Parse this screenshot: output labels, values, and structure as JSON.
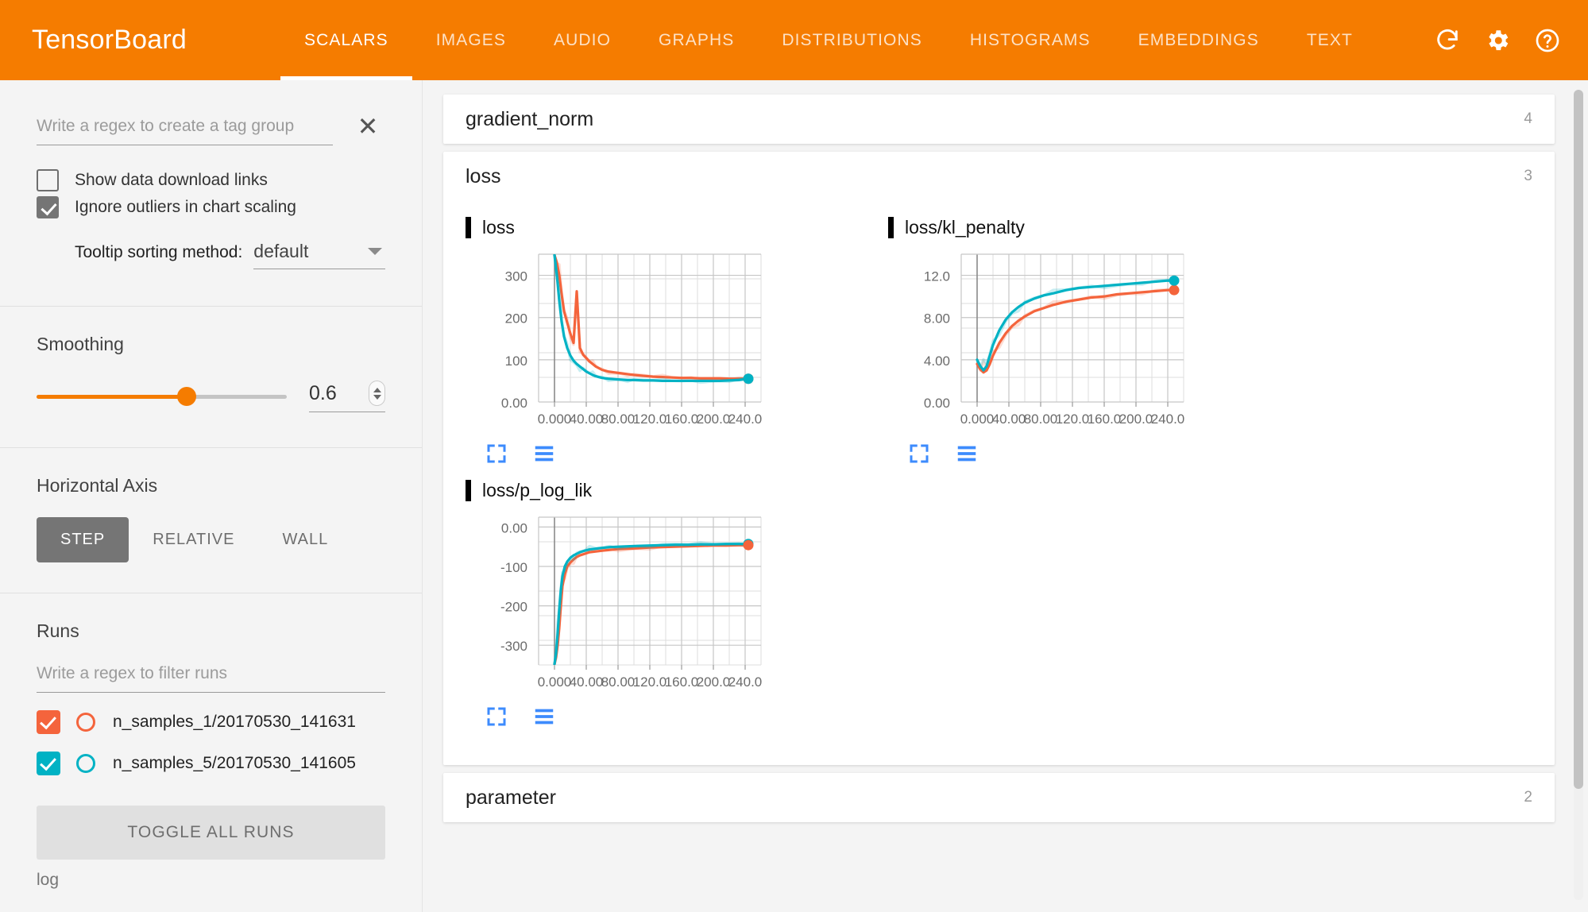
{
  "header": {
    "brand": "TensorBoard",
    "tabs": [
      {
        "label": "SCALARS",
        "active": true
      },
      {
        "label": "IMAGES",
        "active": false
      },
      {
        "label": "AUDIO",
        "active": false
      },
      {
        "label": "GRAPHS",
        "active": false
      },
      {
        "label": "DISTRIBUTIONS",
        "active": false
      },
      {
        "label": "HISTOGRAMS",
        "active": false
      },
      {
        "label": "EMBEDDINGS",
        "active": false
      },
      {
        "label": "TEXT",
        "active": false
      }
    ],
    "icons": [
      "refresh-icon",
      "settings-gear-icon",
      "help-icon"
    ],
    "background": "#f57c00"
  },
  "sidebar": {
    "tag_group_placeholder": "Write a regex to create a tag group",
    "tag_group_value": "",
    "clear_icon": "close-icon",
    "checkboxes": [
      {
        "label": "Show data download links",
        "checked": false
      },
      {
        "label": "Ignore outliers in chart scaling",
        "checked": true
      }
    ],
    "tooltip_sort": {
      "label": "Tooltip sorting method:",
      "value": "default"
    },
    "smoothing": {
      "title": "Smoothing",
      "value": "0.6",
      "fraction": 0.6
    },
    "horizontal_axis": {
      "title": "Horizontal Axis",
      "options": [
        {
          "label": "STEP",
          "active": true
        },
        {
          "label": "RELATIVE",
          "active": false
        },
        {
          "label": "WALL",
          "active": false
        }
      ]
    },
    "runs": {
      "title": "Runs",
      "filter_placeholder": "Write a regex to filter runs",
      "filter_value": "",
      "items": [
        {
          "name": "n_samples_1/20170530_141631",
          "color": "#f4643c",
          "checked": true
        },
        {
          "name": "n_samples_5/20170530_141605",
          "color": "#00b2c4",
          "checked": true
        }
      ],
      "toggle_all_label": "TOGGLE ALL RUNS"
    },
    "log_label": "log"
  },
  "content": {
    "sections": [
      {
        "title": "gradient_norm",
        "count": "4",
        "expanded": false
      },
      {
        "title": "loss",
        "count": "3",
        "expanded": true
      },
      {
        "title": "parameter",
        "count": "2",
        "expanded": false
      }
    ],
    "chart_buttons": [
      "expand-chart-icon",
      "toggle-y-axis-icon"
    ]
  },
  "chart_data": [
    {
      "type": "line",
      "title": "loss",
      "xlabel": "",
      "ylabel": "",
      "xticks": [
        "0.000",
        "40.00",
        "80.00",
        "120.0",
        "160.0",
        "200.0",
        "240.0"
      ],
      "yticks": [
        "300",
        "200",
        "100",
        "0.00"
      ],
      "xlim": [
        -20,
        260
      ],
      "ylim": [
        0,
        350
      ],
      "grid": true,
      "legend": "none",
      "series": [
        {
          "name": "n_samples_1/20170530_141631",
          "color": "#f4643c",
          "x": [
            0,
            3,
            6,
            9,
            12,
            16,
            20,
            24,
            28,
            32,
            36,
            40,
            44,
            48,
            52,
            56,
            60,
            68,
            76,
            84,
            92,
            100,
            112,
            124,
            136,
            148,
            160,
            172,
            184,
            196,
            208,
            220,
            232,
            244
          ],
          "y": [
            348,
            330,
            300,
            255,
            215,
            188,
            162,
            140,
            262,
            128,
            112,
            104,
            96,
            90,
            84,
            80,
            76,
            72,
            70,
            68,
            66,
            64,
            62,
            60,
            59,
            58,
            57,
            57,
            56,
            56,
            56,
            55,
            55,
            55
          ]
        },
        {
          "name": "n_samples_5/20170530_141605",
          "color": "#00b2c4",
          "x": [
            0,
            3,
            6,
            9,
            12,
            16,
            20,
            24,
            28,
            32,
            36,
            40,
            44,
            48,
            52,
            56,
            60,
            68,
            76,
            84,
            92,
            100,
            112,
            124,
            136,
            148,
            160,
            172,
            184,
            196,
            208,
            220,
            232,
            244
          ],
          "y": [
            348,
            300,
            240,
            190,
            155,
            128,
            110,
            98,
            90,
            84,
            78,
            72,
            68,
            64,
            61,
            59,
            57,
            55,
            54,
            53,
            52,
            52,
            51,
            51,
            50,
            50,
            50,
            50,
            50,
            50,
            50,
            51,
            52,
            55
          ]
        }
      ],
      "endpoints": [
        {
          "color": "#f4643c",
          "x": 244,
          "y": 55
        },
        {
          "color": "#00b2c4",
          "x": 244,
          "y": 55
        }
      ]
    },
    {
      "type": "line",
      "title": "loss/kl_penalty",
      "xlabel": "",
      "ylabel": "",
      "xticks": [
        "0.000",
        "40.00",
        "80.00",
        "120.0",
        "160.0",
        "200.0",
        "240.0"
      ],
      "yticks": [
        "12.0",
        "8.00",
        "4.00",
        "0.00"
      ],
      "xlim": [
        -20,
        260
      ],
      "ylim": [
        0,
        14
      ],
      "grid": true,
      "legend": "none",
      "series": [
        {
          "name": "n_samples_1/20170530_141631",
          "color": "#f4643c",
          "x": [
            0,
            4,
            8,
            12,
            16,
            20,
            28,
            36,
            44,
            52,
            60,
            72,
            84,
            96,
            112,
            128,
            144,
            160,
            176,
            192,
            208,
            224,
            240,
            248
          ],
          "y": [
            3.6,
            3.1,
            2.8,
            3.0,
            3.6,
            4.4,
            5.6,
            6.5,
            7.2,
            7.7,
            8.1,
            8.6,
            8.9,
            9.2,
            9.5,
            9.7,
            9.9,
            10.0,
            10.2,
            10.3,
            10.4,
            10.5,
            10.6,
            10.6
          ]
        },
        {
          "name": "n_samples_5/20170530_141605",
          "color": "#00b2c4",
          "x": [
            0,
            4,
            8,
            12,
            16,
            20,
            28,
            36,
            44,
            52,
            60,
            72,
            84,
            96,
            112,
            128,
            144,
            160,
            176,
            192,
            208,
            224,
            240,
            248
          ],
          "y": [
            4.0,
            3.4,
            3.0,
            3.4,
            4.4,
            5.4,
            6.8,
            7.8,
            8.5,
            9.0,
            9.4,
            9.8,
            10.1,
            10.3,
            10.6,
            10.8,
            10.9,
            11.0,
            11.1,
            11.2,
            11.3,
            11.4,
            11.5,
            11.5
          ]
        }
      ],
      "endpoints": [
        {
          "color": "#f4643c",
          "x": 248,
          "y": 10.6
        },
        {
          "color": "#00b2c4",
          "x": 248,
          "y": 11.5
        }
      ]
    },
    {
      "type": "line",
      "title": "loss/p_log_lik",
      "xlabel": "",
      "ylabel": "",
      "xticks": [
        "0.000",
        "40.00",
        "80.00",
        "120.0",
        "160.0",
        "200.0",
        "240.0"
      ],
      "yticks": [
        "0.00",
        "-100",
        "-200",
        "-300"
      ],
      "xlim": [
        -20,
        260
      ],
      "ylim": [
        -350,
        25
      ],
      "grid": true,
      "legend": "none",
      "series": [
        {
          "name": "n_samples_1/20170530_141631",
          "color": "#f4643c",
          "x": [
            0,
            2,
            4,
            6,
            8,
            10,
            13,
            16,
            20,
            24,
            28,
            32,
            38,
            44,
            52,
            60,
            70,
            80,
            92,
            104,
            120,
            136,
            152,
            168,
            184,
            200,
            216,
            232,
            244
          ],
          "y": [
            -348,
            -330,
            -300,
            -256,
            -200,
            -150,
            -120,
            -100,
            -90,
            -82,
            -76,
            -72,
            -68,
            -64,
            -62,
            -60,
            -58,
            -56,
            -55,
            -54,
            -52,
            -51,
            -50,
            -49,
            -48,
            -47,
            -47,
            -46,
            -46
          ]
        },
        {
          "name": "n_samples_5/20170530_141605",
          "color": "#00b2c4",
          "x": [
            0,
            2,
            4,
            6,
            8,
            10,
            13,
            16,
            20,
            24,
            28,
            32,
            38,
            44,
            52,
            60,
            70,
            80,
            92,
            104,
            120,
            136,
            152,
            168,
            184,
            200,
            216,
            232,
            244
          ],
          "y": [
            -348,
            -320,
            -270,
            -210,
            -160,
            -125,
            -100,
            -88,
            -78,
            -72,
            -68,
            -64,
            -60,
            -57,
            -55,
            -53,
            -51,
            -50,
            -49,
            -48,
            -47,
            -46,
            -45,
            -45,
            -44,
            -44,
            -43,
            -43,
            -43
          ]
        }
      ],
      "endpoints": [
        {
          "color": "#00b2c4",
          "x": 244,
          "y": -43
        },
        {
          "color": "#f4643c",
          "x": 244,
          "y": -46
        }
      ]
    }
  ]
}
